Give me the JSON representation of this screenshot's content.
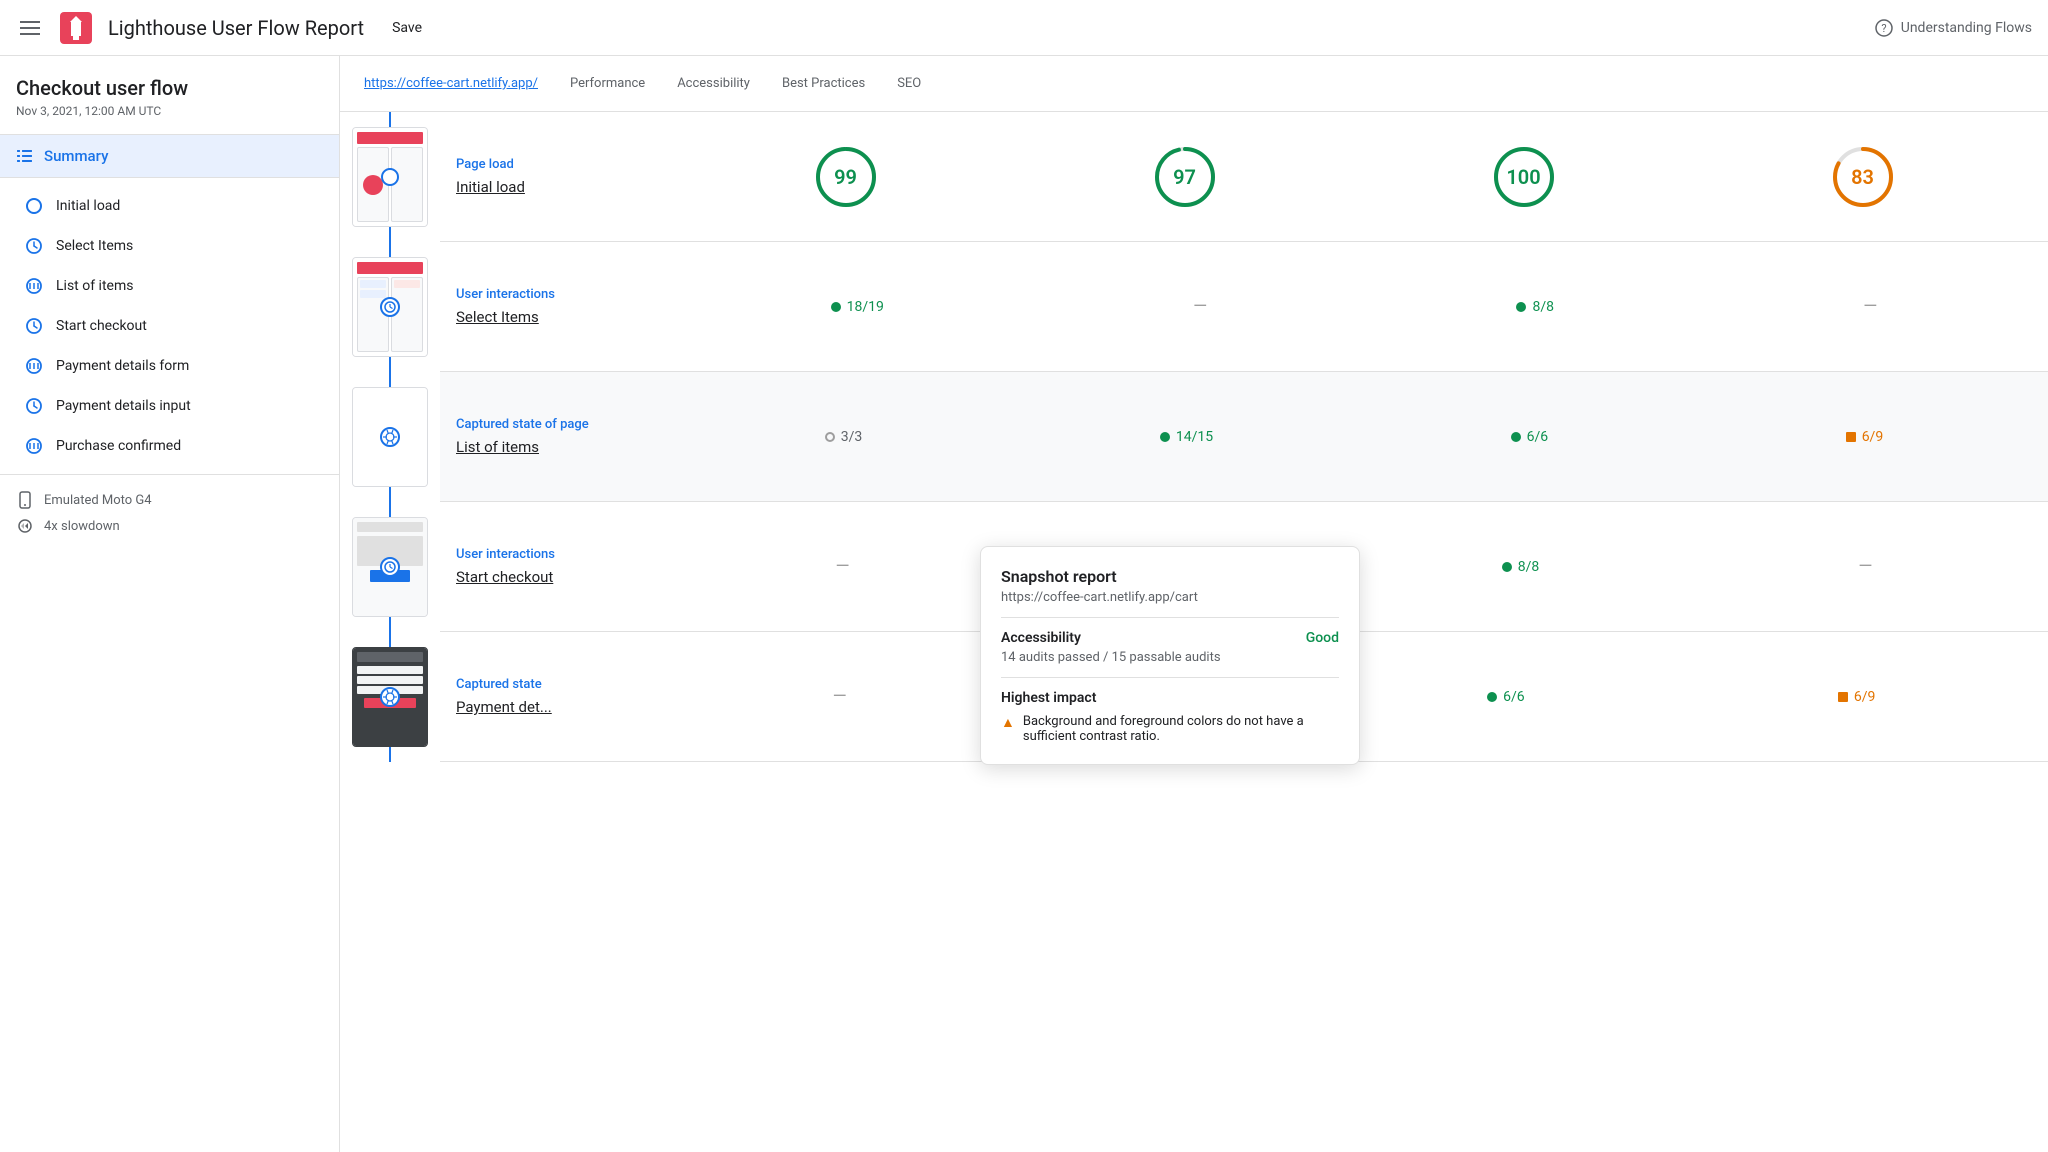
{
  "topbar": {
    "menu_icon": "hamburger-icon",
    "logo_icon": "lighthouse-logo-icon",
    "title": "Lighthouse User Flow Report",
    "save_label": "Save",
    "help_label": "Understanding Flows",
    "help_icon": "help-circle-icon"
  },
  "sidebar": {
    "flow_title": "Checkout user flow",
    "date": "Nov 3, 2021, 12:00 AM UTC",
    "summary_label": "Summary",
    "items": [
      {
        "id": "initial-load",
        "label": "Initial load",
        "type": "navigation"
      },
      {
        "id": "select-items",
        "label": "Select Items",
        "type": "user-interaction"
      },
      {
        "id": "list-of-items",
        "label": "List of items",
        "type": "snapshot"
      },
      {
        "id": "start-checkout",
        "label": "Start checkout",
        "type": "user-interaction"
      },
      {
        "id": "payment-details-form",
        "label": "Payment details form",
        "type": "snapshot"
      },
      {
        "id": "payment-details-input",
        "label": "Payment details input",
        "type": "user-interaction"
      },
      {
        "id": "purchase-confirmed",
        "label": "Purchase confirmed",
        "type": "snapshot"
      }
    ],
    "device_label": "Emulated Moto G4",
    "slowdown_label": "4x slowdown"
  },
  "content": {
    "url": "https://coffee-cart.netlify.app/",
    "tabs": [
      "Performance",
      "Accessibility",
      "Best Practices",
      "SEO"
    ],
    "sections": [
      {
        "type_label": "Page load",
        "name": "Initial load",
        "scores": {
          "performance": 99,
          "accessibility": 97,
          "best_practices": 100,
          "seo": 83
        }
      },
      {
        "type_label": "User interactions",
        "name": "Select Items",
        "scores": {
          "performance": "18/19",
          "accessibility": "—",
          "best_practices": "8/8",
          "seo": "—"
        }
      },
      {
        "type_label": "Captured state of page",
        "name": "List of items",
        "scores": {
          "performance": "3/3",
          "accessibility": "14/15",
          "best_practices": "6/6",
          "seo": "6/9"
        }
      },
      {
        "type_label": "User interactions",
        "name": "Start checkout",
        "scores": {
          "performance": "—",
          "accessibility": "—",
          "best_practices": "8/8",
          "seo": "—"
        }
      },
      {
        "type_label": "Captured state",
        "name": "Payment details form",
        "scores": {
          "performance": "—",
          "accessibility": "—",
          "best_practices": "6/6",
          "seo": "6/9"
        }
      }
    ]
  },
  "tooltip": {
    "title": "Snapshot report",
    "url": "https://coffee-cart.netlify.app/cart",
    "accessibility_label": "Accessibility",
    "accessibility_value": "Good",
    "accessibility_desc": "14 audits passed / 15 passable audits",
    "highest_impact_label": "Highest impact",
    "impact_item": "Background and foreground colors do not have a sufficient contrast ratio."
  }
}
